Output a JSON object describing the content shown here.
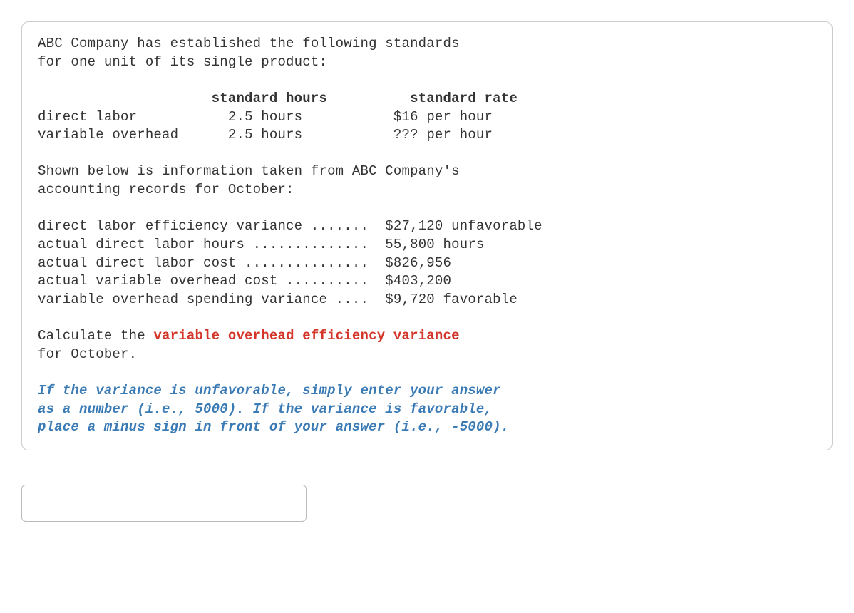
{
  "intro_line1": "ABC Company has established the following standards",
  "intro_line2": "for one unit of its single product:",
  "heading_hours": "standard hours",
  "heading_rate": "standard rate",
  "row_dl_label": "direct labor",
  "row_dl_hours": "2.5 hours",
  "row_dl_rate": "$16 per hour",
  "row_voh_label": "variable overhead",
  "row_voh_hours": "2.5 hours",
  "row_voh_rate": "??? per hour",
  "para2_line1": "Shown below is information taken from ABC Company's",
  "para2_line2": "accounting records for October:",
  "rec1_label": "direct labor efficiency variance .......",
  "rec1_value": "$27,120 unfavorable",
  "rec2_label": "actual direct labor hours ..............",
  "rec2_value": "55,800 hours",
  "rec3_label": "actual direct labor cost ...............",
  "rec3_value": "$826,956",
  "rec4_label": "actual variable overhead cost ..........",
  "rec4_value": "$403,200",
  "rec5_label": "variable overhead spending variance ....",
  "rec5_value": "$9,720 favorable",
  "calc_prefix": "Calculate the ",
  "calc_target": "variable overhead efficiency variance",
  "calc_suffix": "for October.",
  "instr_line1": "If the variance is unfavorable, simply enter your answer",
  "instr_line2": "as a number (i.e., 5000). If the variance is favorable,",
  "instr_line3": "place a minus sign in front of your answer (i.e., -5000).",
  "answer_value": ""
}
